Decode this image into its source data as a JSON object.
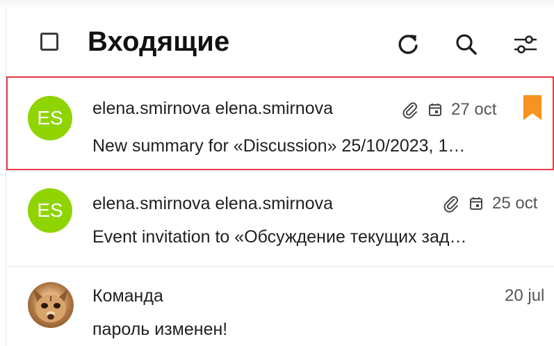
{
  "header": {
    "title": "Входящие",
    "icons": [
      "refresh-icon",
      "search-icon",
      "filter-icon"
    ]
  },
  "messages": [
    {
      "avatar_initials": "ES",
      "avatar_color": "#8fd400",
      "sender": "elena.smirnova elena.smirnova",
      "subject": "New summary for «Discussion» 25/10/2023, 1…",
      "date": "27 oct",
      "has_attachment": true,
      "has_event": true,
      "bookmarked": true,
      "selected": true
    },
    {
      "avatar_initials": "ES",
      "avatar_color": "#8fd400",
      "sender": "elena.smirnova elena.smirnova",
      "subject": "Event invitation to «Обсуждение текущих зад…",
      "date": "25 oct",
      "has_attachment": true,
      "has_event": true,
      "bookmarked": false,
      "selected": false
    },
    {
      "avatar_initials": "",
      "sender": "Команда",
      "subject": "пароль изменен!",
      "date": "20 jul",
      "has_attachment": false,
      "has_event": false,
      "bookmarked": false,
      "selected": false
    }
  ],
  "colors": {
    "selected_border": "#e53945",
    "bookmark": "#f7931e",
    "avatar_green": "#8fd400"
  }
}
